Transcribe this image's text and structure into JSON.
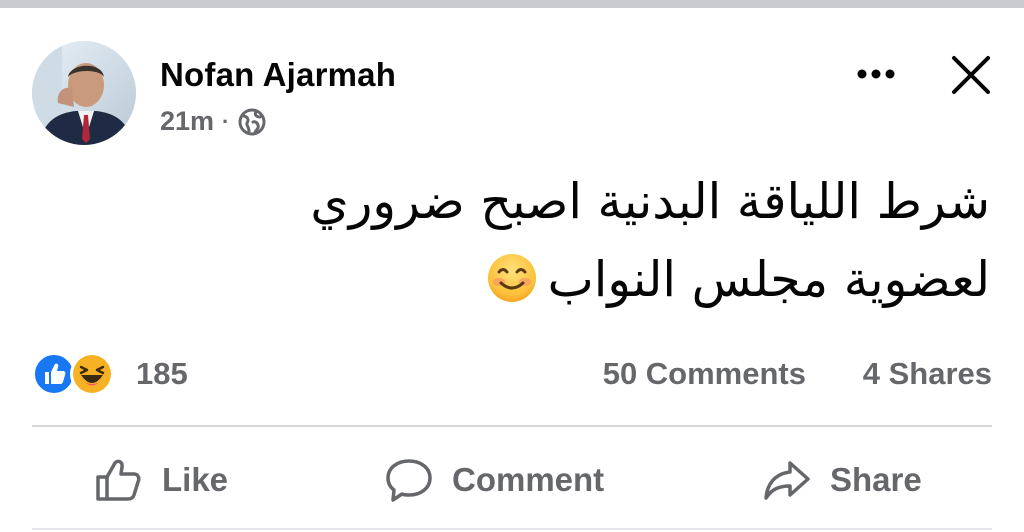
{
  "post": {
    "author": "Nofan Ajarmah",
    "time": "21m",
    "separator": "·",
    "privacy_icon": "globe-icon",
    "text_line1": "شرط اللياقة البدنية اصبح ضروري",
    "text_line2": "لعضوية مجلس النواب",
    "emoji": "smiling-face-emoji"
  },
  "header_actions": {
    "more_icon": "more-horizontal-icon",
    "close_icon": "close-icon"
  },
  "reactions": {
    "types": [
      "like",
      "haha"
    ],
    "count": "185"
  },
  "engagement": {
    "comments": "50 Comments",
    "shares": "4 Shares"
  },
  "actions": {
    "like": "Like",
    "comment": "Comment",
    "share": "Share"
  },
  "colors": {
    "text_primary": "#050505",
    "text_secondary": "#65676b",
    "like_blue": "#1877f2",
    "haha_yellow": "#f7b125"
  }
}
